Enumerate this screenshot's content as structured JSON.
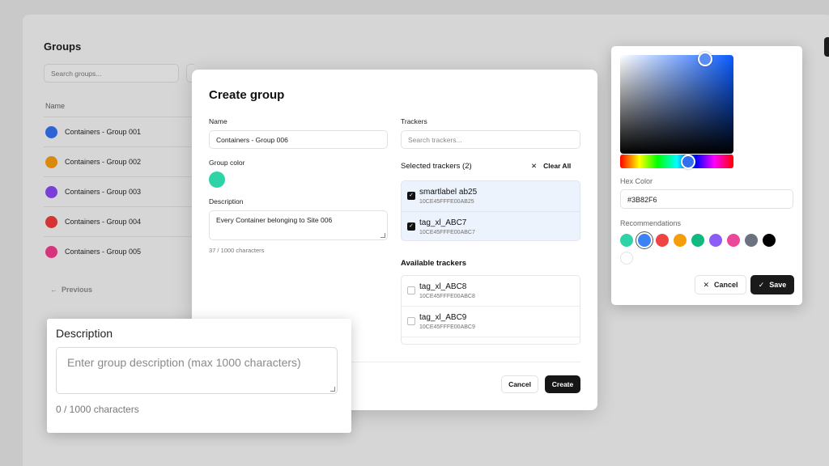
{
  "background": {
    "title": "Groups",
    "search_placeholder": "Search groups...",
    "column_name": "Name",
    "groups": [
      {
        "name": "Containers - Group 001",
        "color": "#2e63d6"
      },
      {
        "name": "Containers - Group 002",
        "color": "#d98a0b"
      },
      {
        "name": "Containers - Group 003",
        "color": "#7a3fd6"
      },
      {
        "name": "Containers - Group 004",
        "color": "#d43434"
      },
      {
        "name": "Containers - Group 005",
        "color": "#d6357e"
      }
    ],
    "previous_label": "Previous"
  },
  "modal": {
    "title": "Create group",
    "name_label": "Name",
    "name_value": "Containers - Group 006",
    "group_color_label": "Group color",
    "group_color": "#2ed3a6",
    "description_label": "Description",
    "description_value": "Every Container belonging to Site 006",
    "description_count": "37 / 1000 characters",
    "trackers_label": "Trackers",
    "trackers_placeholder": "Search trackers...",
    "selected_heading": "Selected trackers (2)",
    "clear_all_label": "Clear All",
    "selected_trackers": [
      {
        "name": "smartlabel ab25",
        "id": "10CE45FFFE00AB25",
        "checked": true
      },
      {
        "name": "tag_xl_ABC7",
        "id": "10CE45FFFE00ABC7",
        "checked": true
      }
    ],
    "available_heading": "Available trackers",
    "available_trackers": [
      {
        "name": "tag_xl_ABC8",
        "id": "10CE45FFFE00ABC8",
        "checked": false
      },
      {
        "name": "tag_xl_ABC9",
        "id": "10CE45FFFE00ABC9",
        "checked": false
      }
    ],
    "cancel_label": "Cancel",
    "create_label": "Create"
  },
  "picker": {
    "hex_label": "Hex Color",
    "hex_value": "#3B82F6",
    "recommendations_label": "Recommendations",
    "recommendations": [
      "#2ed3a6",
      "#3b82f6",
      "#ef4444",
      "#f59e0b",
      "#10b981",
      "#8b5cf6",
      "#ec4899",
      "#6b7280",
      "#000000",
      "#ffffff"
    ],
    "selected_index": 1,
    "cancel_label": "Cancel",
    "save_label": "Save"
  },
  "callout": {
    "label": "Description",
    "placeholder": "Enter group description (max 1000 characters)",
    "count": "0 / 1000 characters"
  }
}
